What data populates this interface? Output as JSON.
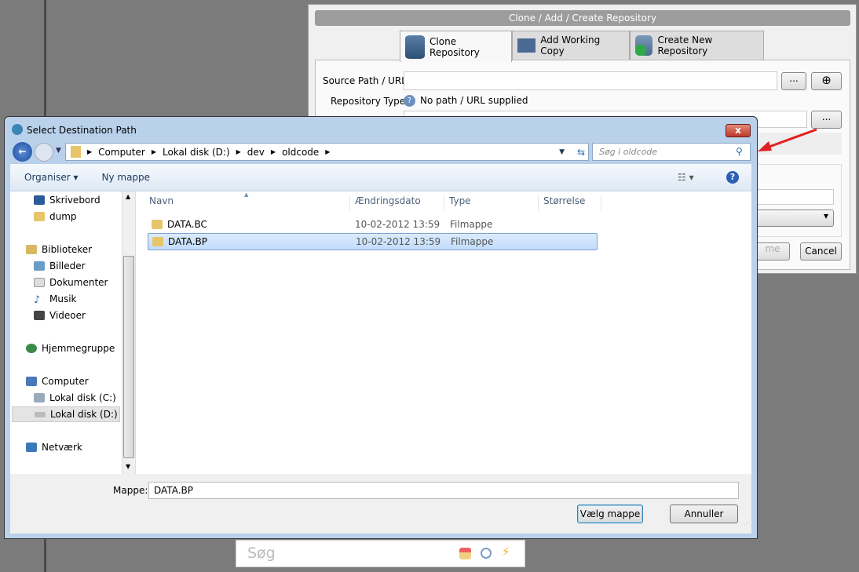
{
  "back_dialog": {
    "title": "Clone  / Add / Create Repository",
    "tabs": [
      {
        "label": "Clone Repository",
        "active": true
      },
      {
        "label": "Add Working Copy"
      },
      {
        "label": "Create New Repository"
      }
    ],
    "source_label": "Source Path / URL:",
    "source_value": "",
    "browse_label": "...",
    "repo_type_label": "Repository Type:",
    "repo_type_value": "No path / URL supplied",
    "dest_browse_label": "...",
    "ok_partial": "me",
    "cancel_label": "Cancel"
  },
  "dialog": {
    "title": "Select Destination Path",
    "close_label": "x",
    "breadcrumb": [
      "Computer",
      "Lokal disk (D:)",
      "dev",
      "oldcode"
    ],
    "search_placeholder": "Søg i oldcode",
    "toolbar": {
      "organise": "Organiser ▾",
      "new_folder": "Ny mappe"
    },
    "nav": {
      "favorites": [
        "Skrivebord",
        "dump"
      ],
      "libraries_header": "Biblioteker",
      "libraries": [
        "Billeder",
        "Dokumenter",
        "Musik",
        "Videoer"
      ],
      "homegroup": "Hjemmegruppe",
      "computer_header": "Computer",
      "drives": [
        "Lokal disk (C:)",
        "Lokal disk (D:)"
      ],
      "network": "Netværk"
    },
    "columns": [
      "Navn",
      "Ændringsdato",
      "Type",
      "Størrelse"
    ],
    "files": [
      {
        "name": "DATA.BC",
        "date": "10-02-2012 13:59",
        "type": "Filmappe",
        "selected": false
      },
      {
        "name": "DATA.BP",
        "date": "10-02-2012 13:59",
        "type": "Filmappe",
        "selected": true
      }
    ],
    "folder_label": "Mappe:",
    "folder_value": "DATA.BP",
    "select_label": "Vælg mappe",
    "cancel_label": "Annuller"
  },
  "search_box": {
    "placeholder": "Søg"
  },
  "colors": {
    "accent_arrow": "#e02020",
    "selection": "#c1dcfc",
    "chrome": "#b9d1ea"
  }
}
